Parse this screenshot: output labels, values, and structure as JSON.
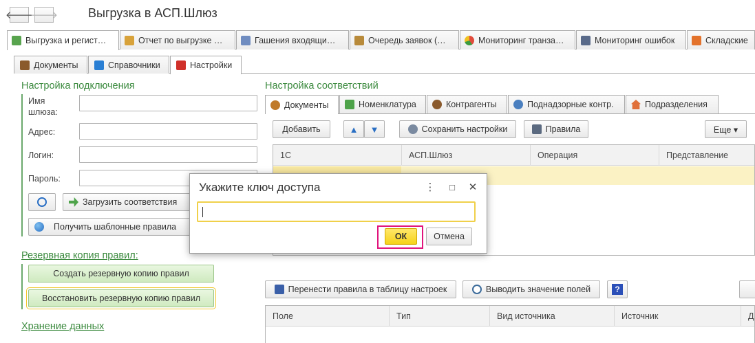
{
  "window": {
    "title": "Выгрузка в АСП.Шлюз",
    "back_glyph": "🡐",
    "forward_glyph": "🡒"
  },
  "main_tabs": [
    {
      "label": "Выгрузка и регист…",
      "icon": "green-doc-icon",
      "color": "#58a44e"
    },
    {
      "label": "Отчет по выгрузке …",
      "icon": "report-icon",
      "color": "#d8a23a"
    },
    {
      "label": "Гашения входящи…",
      "icon": "list-icon",
      "color": "#6f8cc0"
    },
    {
      "label": "Очередь заявок (…",
      "icon": "queue-icon",
      "color": "#b88a3a"
    },
    {
      "label": "Мониторинг транза…",
      "icon": "pie-chart-icon",
      "color": "#e14b3b"
    },
    {
      "label": "Мониторинг ошибок",
      "icon": "monitor-icon",
      "color": "#5a6b8a"
    },
    {
      "label": "Складские",
      "icon": "warehouse-icon",
      "color": "#e3722b"
    }
  ],
  "sub_tabs": [
    {
      "label": "Документы",
      "icon": "briefcase-icon",
      "color": "#8a5a2c"
    },
    {
      "label": "Справочники",
      "icon": "book-icon",
      "color": "#2a7fd4"
    },
    {
      "label": "Настройки",
      "icon": "settings-toolbox-icon",
      "color": "#d0302a"
    }
  ],
  "connection": {
    "title": "Настройка подключения",
    "gateway_label": "Имя шлюза:",
    "address_label": "Адрес:",
    "login_label": "Логин:",
    "password_label": "Пароль:",
    "load_mappings_label": "Загрузить соответствия",
    "get_templates_label": "Получить шаблонные правила"
  },
  "backup": {
    "title": "Резервная копия правил:",
    "create_label": "Создать резервную копию правил",
    "restore_label": "Восстановить резервную копию правил"
  },
  "storage": {
    "title": "Хранение данных"
  },
  "mapping": {
    "title": "Настройка соответствий",
    "tabs": [
      {
        "label": "Документы",
        "icon": "gears-icon",
        "color": "#c07a2a"
      },
      {
        "label": "Номенклатура",
        "icon": "basket-icon",
        "color": "#4ea34a"
      },
      {
        "label": "Контрагенты",
        "icon": "people-icon",
        "color": "#8a5a2c"
      },
      {
        "label": "Поднадзорные контр.",
        "icon": "target-icon",
        "color": "#4a7fbf"
      },
      {
        "label": "Подразделения",
        "icon": "house-icon",
        "color": "#e0703a"
      }
    ],
    "add_label": "Добавить",
    "save_settings_label": "Сохранить настройки",
    "rules_label": "Правила",
    "more_label": "Еще ▾",
    "columns": [
      "1С",
      "АСП.Шлюз",
      "Операция",
      "Представление"
    ],
    "transfer_label": "Перенести правила в таблицу настроек",
    "show_fields_label": "Выводить значение полей",
    "help_glyph": "?",
    "fields_columns": [
      "Поле",
      "Тип",
      "Вид источника",
      "Источник",
      "Д"
    ]
  },
  "dialog": {
    "title": "Укажите ключ доступа",
    "input_value": "",
    "ok_label": "ОК",
    "cancel_label": "Отмена",
    "more_glyph": "⋮",
    "maximize_glyph": "□",
    "close_glyph": "✕"
  }
}
